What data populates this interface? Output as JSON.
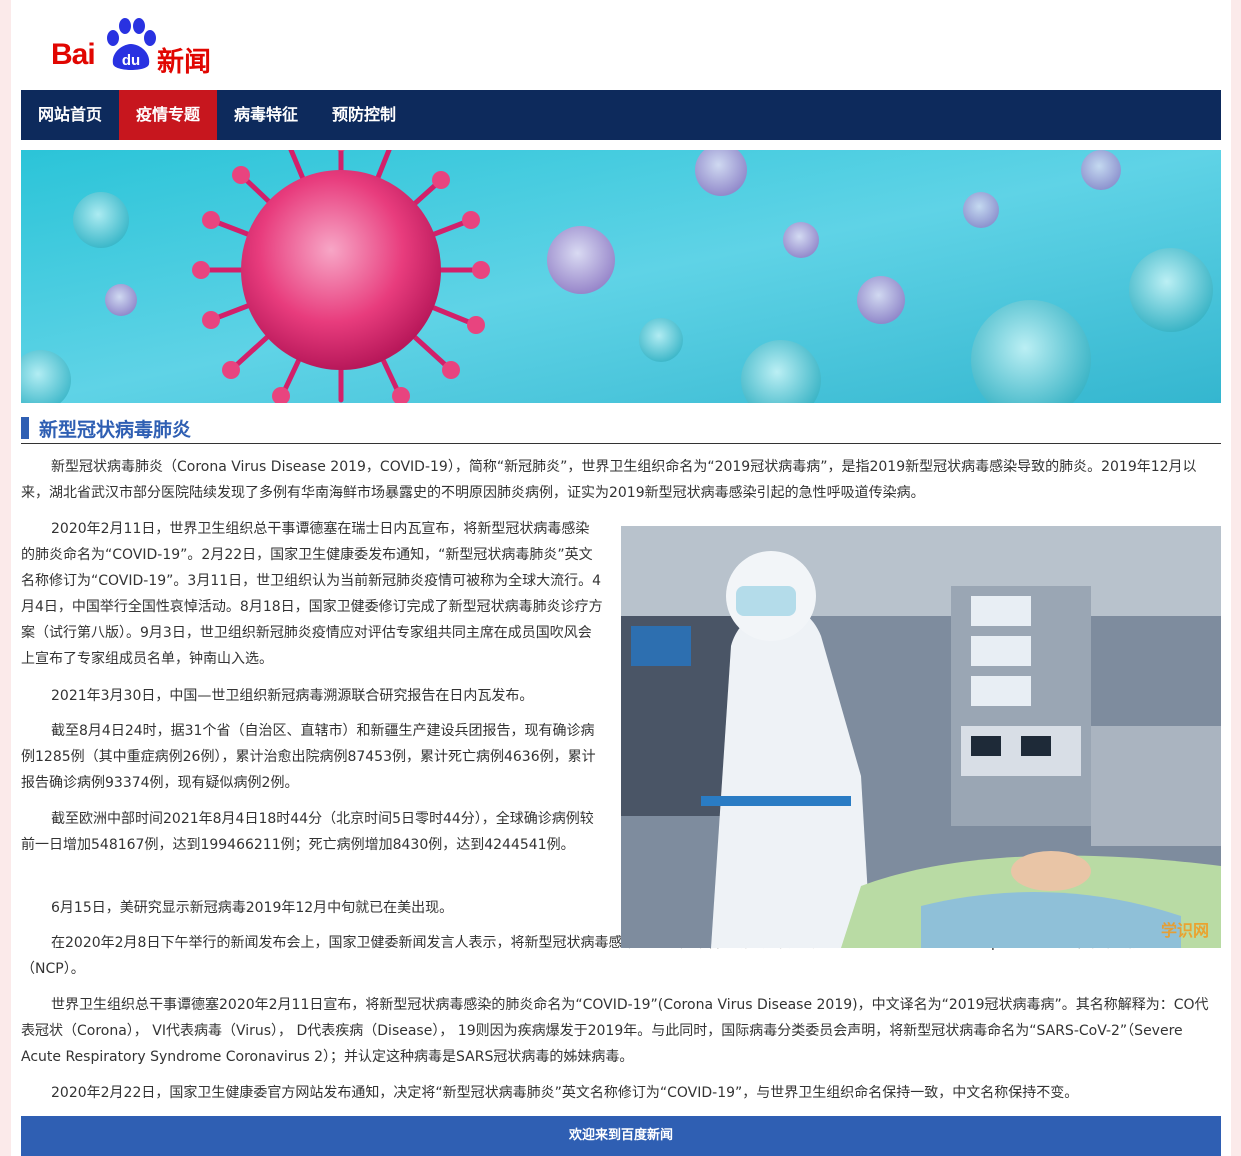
{
  "brand": {
    "logo_text": "Bai",
    "logo_du": "du",
    "logo_news": "新闻"
  },
  "nav": {
    "items": [
      {
        "label": "网站首页"
      },
      {
        "label": "疫情专题"
      },
      {
        "label": "病毒特征"
      },
      {
        "label": "预防控制"
      }
    ],
    "active_index": 1
  },
  "section": {
    "title": "新型冠状病毒肺炎"
  },
  "content": {
    "paragraphs": [
      "新型冠状病毒肺炎（Corona Virus Disease 2019，COVID-19），简称“新冠肺炎”，世界卫生组织命名为“2019冠状病毒病”，是指2019新型冠状病毒感染导致的肺炎。2019年12月以来，湖北省武汉市部分医院陆续发现了多例有华南海鲜市场暴露史的不明原因肺炎病例，证实为2019新型冠状病毒感染引起的急性呼吸道传染病。",
      "2020年2月11日，世界卫生组织总干事谭德塞在瑞士日内瓦宣布，将新型冠状病毒感染的肺炎命名为“COVID-19”。2月22日，国家卫生健康委发布通知，“新型冠状病毒肺炎”英文名称修订为“COVID-19”。3月11日，世卫组织认为当前新冠肺炎疫情可被称为全球大流行。4月4日，中国举行全国性哀悼活动。8月18日，国家卫健委修订完成了新型冠状病毒肺炎诊疗方案（试行第八版）。9月3日，世卫组织新冠肺炎疫情应对评估专家组共同主席在成员国吹风会上宣布了专家组成员名单，钟南山入选。",
      "2021年3月30日，中国—世卫组织新冠病毒溯源联合研究报告在日内瓦发布。",
      "截至8月4日24时，据31个省（自治区、直辖市）和新疆生产建设兵团报告，现有确诊病例1285例（其中重症病例26例），累计治愈出院病例87453例，累计死亡病例4636例，累计报告确诊病例93374例，现有疑似病例2例。",
      "截至欧洲中部时间2021年8月4日18时44分（北京时间5日零时44分），全球确诊病例较前一日增加548167例，达到199466211例；死亡病例增加8430例，达到4244541例。",
      "6月15日，美研究显示新冠病毒2019年12月中旬就已在美出现。",
      "在2020年2月8日下午举行的新闻发布会上，国家卫健委新闻发言人表示，将新型冠状病毒感染的肺炎暂命名为新型冠状病毒肺炎（Novel coronavirus pneumonia），简称新冠肺炎（NCP）。",
      "世界卫生组织总干事谭德塞2020年2月11日宣布，将新型冠状病毒感染的肺炎命名为“COVID-19”(Corona Virus Disease 2019)，中文译名为“2019冠状病毒病”。其名称解释为：CO代表冠状（Corona）， VI代表病毒（Virus）， D代表疾病（Disease）， 19则因为疾病爆发于2019年。与此同时，国际病毒分类委员会声明，将新型冠状病毒命名为“SARS-CoV-2”（Severe Acute Respiratory Syndrome Coronavirus 2）；并认定这种病毒是SARS冠状病毒的姊妹病毒。",
      "2020年2月22日，国家卫生健康委官方网站发布通知，决定将“新型冠状病毒肺炎”英文名称修订为“COVID-19”，与世界卫生组织命名保持一致，中文名称保持不变。"
    ]
  },
  "watermark": "学识网",
  "footer": {
    "text": "欢迎来到百度新闻"
  },
  "colors": {
    "brand_red": "#e10601",
    "nav_bg": "#0d2a5c",
    "nav_active": "#c7161e",
    "accent_blue": "#2f5fb3"
  }
}
